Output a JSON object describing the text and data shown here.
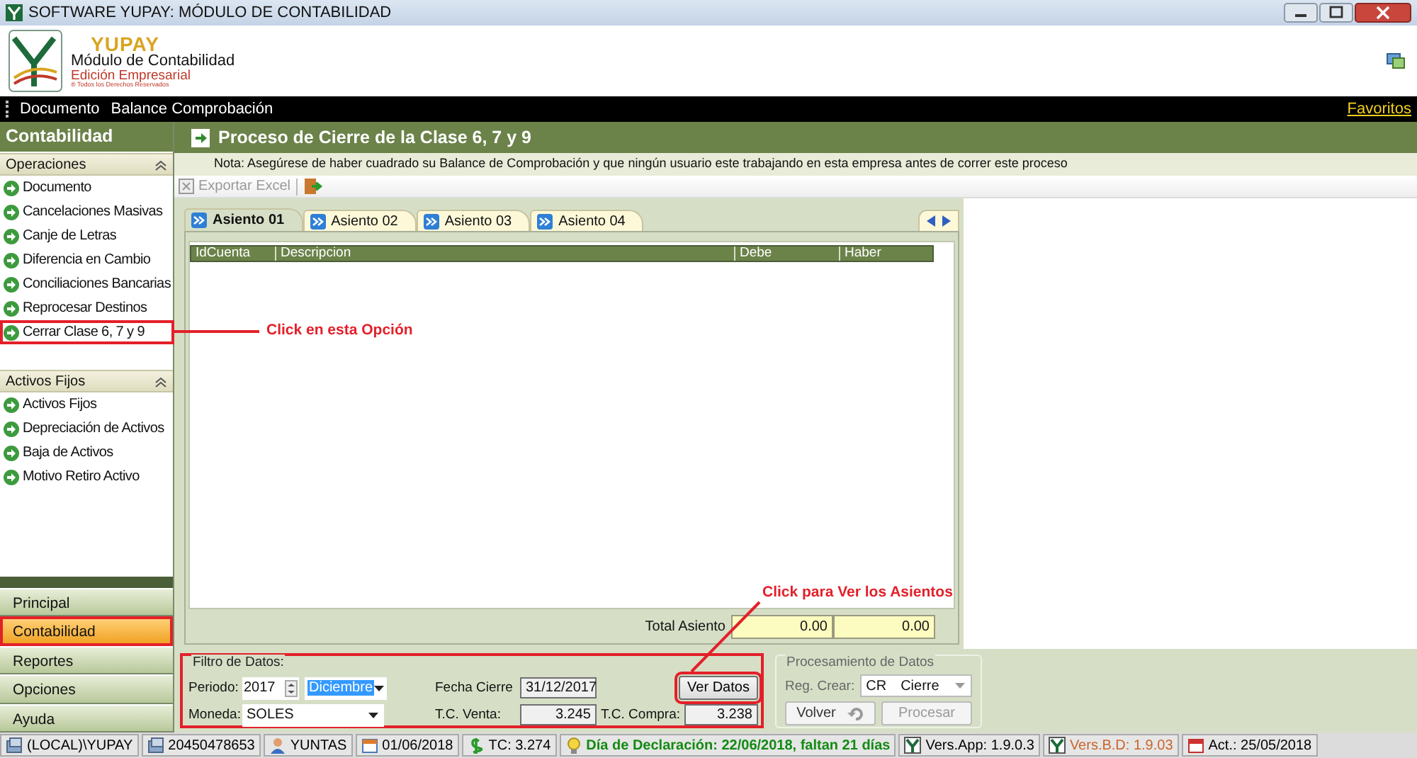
{
  "window": {
    "title": "SOFTWARE YUPAY: MÓDULO DE CONTABILIDAD"
  },
  "header": {
    "brand": "YUPAY",
    "module": "Módulo de Contabilidad",
    "edition": "Edición Empresarial",
    "rights": "® Todos los Derechos Reservados"
  },
  "menu": {
    "items": [
      "Documento",
      "Balance Comprobación"
    ],
    "favorites": "Favoritos"
  },
  "sidebar": {
    "title": "Contabilidad",
    "sections": [
      {
        "title": "Operaciones",
        "expanded": true,
        "items": [
          {
            "label": "Documento",
            "highlighted": false
          },
          {
            "label": "Cancelaciones Masivas",
            "highlighted": false
          },
          {
            "label": "Canje de Letras",
            "highlighted": false
          },
          {
            "label": "Diferencia en Cambio",
            "highlighted": false
          },
          {
            "label": "Conciliaciones Bancarias",
            "highlighted": false
          },
          {
            "label": "Reprocesar Destinos",
            "highlighted": false
          },
          {
            "label": "Cerrar Clase 6, 7 y 9",
            "highlighted": true
          }
        ]
      },
      {
        "title": "Activos Fijos",
        "expanded": true,
        "items": [
          {
            "label": "Activos Fijos",
            "highlighted": false
          },
          {
            "label": "Depreciación de Activos",
            "highlighted": false
          },
          {
            "label": "Baja de Activos",
            "highlighted": false
          },
          {
            "label": "Motivo Retiro Activo",
            "highlighted": false
          }
        ]
      }
    ]
  },
  "nav": [
    {
      "label": "Principal",
      "selected": false,
      "highlighted": false
    },
    {
      "label": "Contabilidad",
      "selected": true,
      "highlighted": true
    },
    {
      "label": "Reportes",
      "selected": false,
      "highlighted": false
    },
    {
      "label": "Opciones",
      "selected": false,
      "highlighted": false
    },
    {
      "label": "Ayuda",
      "selected": false,
      "highlighted": false
    }
  ],
  "panel": {
    "title": "Proceso de Cierre de la Clase 6, 7 y 9",
    "note": "Nota: Asegúrese de haber cuadrado su Balance de Comprobación y que ningún usuario este trabajando en esta empresa antes de correr este proceso",
    "export": "Exportar Excel"
  },
  "tabs": [
    {
      "label": "Asiento 01",
      "selected": true
    },
    {
      "label": "Asiento 02",
      "selected": false
    },
    {
      "label": "Asiento 03",
      "selected": false
    },
    {
      "label": "Asiento 04",
      "selected": false
    }
  ],
  "table": {
    "columns": [
      "IdCuenta",
      "Descripcion",
      "Debe",
      "Haber"
    ]
  },
  "total": {
    "label": "Total Asiento",
    "debe": "0.00",
    "haber": "0.00"
  },
  "filter": {
    "title": "Filtro de Datos:",
    "highlighted": true,
    "periodo_label": "Periodo:",
    "year": "2017",
    "month": "Diciembre",
    "moneda_label": "Moneda:",
    "moneda": "SOLES",
    "fecha_cierre_label": "Fecha Cierre",
    "fecha_cierre": "31/12/2017",
    "tc_venta_label": "T.C. Venta:",
    "tc_venta": "3.245",
    "tc_compra_label": "T.C. Compra:",
    "tc_compra": "3.238",
    "view_button": {
      "label": "Ver Datos",
      "highlighted": true
    }
  },
  "processing": {
    "title": "Procesamiento de Datos",
    "reg_label": "Reg. Crear:",
    "reg_code": "CR",
    "reg_value": "Cierre",
    "back": {
      "label": "Volver",
      "disabled": false
    },
    "process": {
      "label": "Procesar",
      "disabled": true
    }
  },
  "annotations": [
    {
      "text": "Click en esta Opción"
    },
    {
      "text": "Click para Ver los Asientos"
    }
  ],
  "status_bar": [
    {
      "kind": "server",
      "text": "(LOCAL)\\YUPAY",
      "color": "#000000",
      "bold": false
    },
    {
      "kind": "server",
      "text": "20450478653",
      "color": "#000000",
      "bold": false
    },
    {
      "kind": "user",
      "text": "YUNTAS",
      "color": "#000000",
      "bold": false
    },
    {
      "kind": "calendar",
      "text": "01/06/2018",
      "color": "#000000",
      "bold": false
    },
    {
      "kind": "money",
      "text": "TC: 3.274",
      "color": "#000000",
      "bold": false
    },
    {
      "kind": "bulb",
      "text": "Día de Declaración: 22/06/2018, faltan 21 días",
      "color": "#138a13",
      "bold": true
    },
    {
      "kind": "version",
      "text": "Vers.App: 1.9.0.3",
      "color": "#000000",
      "bold": false
    },
    {
      "kind": "version",
      "text": "Vers.B.D: 1.9.03",
      "color": "#c8642a",
      "bold": false
    },
    {
      "kind": "date",
      "text": "Act.: 25/05/2018",
      "color": "#000000",
      "bold": false
    }
  ]
}
